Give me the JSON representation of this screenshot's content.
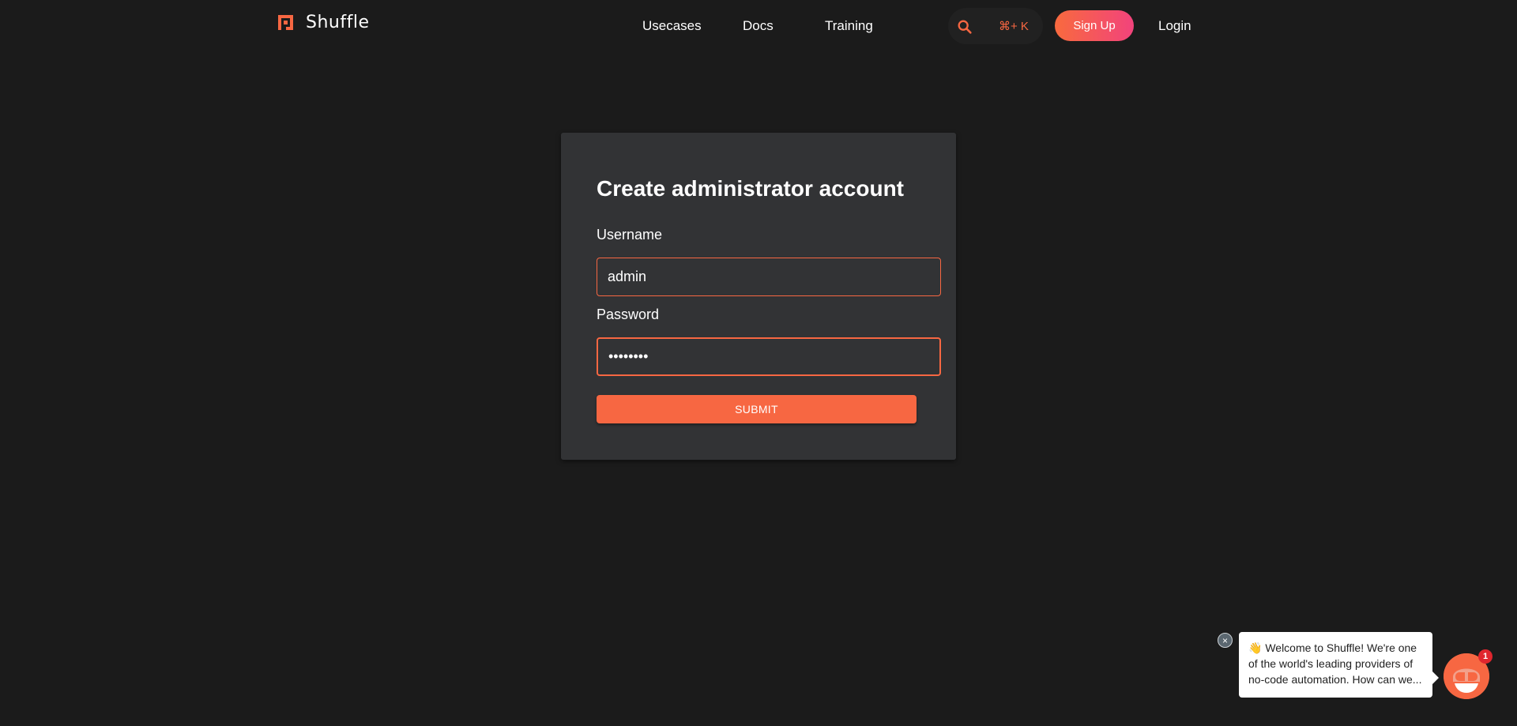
{
  "header": {
    "brand": "Shuffle",
    "nav": [
      {
        "label": "Usecases"
      },
      {
        "label": "Docs"
      },
      {
        "label": "Training"
      }
    ],
    "search_shortcut": "⌘+ K",
    "signup_label": "Sign Up",
    "login_label": "Login"
  },
  "form": {
    "title": "Create administrator account",
    "username_label": "Username",
    "username_value": "admin",
    "password_label": "Password",
    "password_value": "••••••••",
    "submit_label": "SUBMIT"
  },
  "chat": {
    "close_glyph": "×",
    "message": "👋 Welcome to Shuffle! We're one of the world's leading providers of no-code automation. How can we...",
    "unread_count": "1"
  },
  "colors": {
    "accent": "#f76742",
    "background": "#1b1b1b",
    "card": "#323335"
  }
}
